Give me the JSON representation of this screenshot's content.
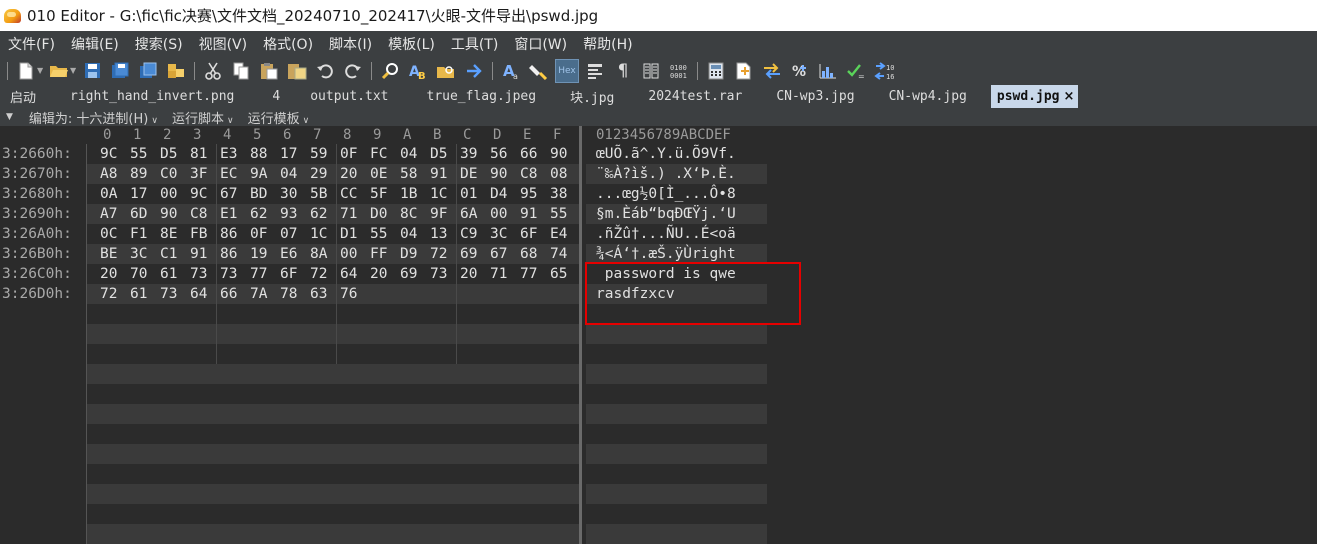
{
  "window": {
    "title": "010 Editor - G:\\fic\\fic决赛\\文件文档_20240710_202417\\火眼-文件导出\\pswd.jpg"
  },
  "menu": [
    "文件(F)",
    "编辑(E)",
    "搜索(S)",
    "视图(V)",
    "格式(O)",
    "脚本(I)",
    "模板(L)",
    "工具(T)",
    "窗口(W)",
    "帮助(H)"
  ],
  "toolbar": {
    "hex_label": "Hex",
    "pilcrow": "¶"
  },
  "tabs": [
    {
      "label": "启动",
      "active": false
    },
    {
      "label": "right_hand_invert.png",
      "active": false
    },
    {
      "label": "4",
      "active": false
    },
    {
      "label": "output.txt",
      "active": false
    },
    {
      "label": "true_flag.jpeg",
      "active": false
    },
    {
      "label": "块.jpg",
      "active": false
    },
    {
      "label": "2024test.rar",
      "active": false
    },
    {
      "label": "CN-wp3.jpg",
      "active": false
    },
    {
      "label": "CN-wp4.jpg",
      "active": false
    },
    {
      "label": "pswd.jpg",
      "active": true
    }
  ],
  "tab_close": "×",
  "editbar": {
    "edit_as": "编辑为: 十六进制(H)",
    "run_script": "运行脚本",
    "run_template": "运行模板"
  },
  "hex_header": [
    "0",
    "1",
    "2",
    "3",
    "4",
    "5",
    "6",
    "7",
    "8",
    "9",
    "A",
    "B",
    "C",
    "D",
    "E",
    "F"
  ],
  "ascii_header": "0123456789ABCDEF",
  "rows": [
    {
      "addr": "3:2660h:",
      "hex": [
        "9C",
        "55",
        "D5",
        "81",
        "E3",
        "88",
        "17",
        "59",
        "0F",
        "FC",
        "04",
        "D5",
        "39",
        "56",
        "66",
        "90"
      ],
      "ascii": "œUÕ.ã^.Y.ü.Õ9Vf."
    },
    {
      "addr": "3:2670h:",
      "hex": [
        "A8",
        "89",
        "C0",
        "3F",
        "EC",
        "9A",
        "04",
        "29",
        "20",
        "0E",
        "58",
        "91",
        "DE",
        "90",
        "C8",
        "08"
      ],
      "ascii": "¨‰À?ìš.) .X‘Þ.È."
    },
    {
      "addr": "3:2680h:",
      "hex": [
        "0A",
        "17",
        "00",
        "9C",
        "67",
        "BD",
        "30",
        "5B",
        "CC",
        "5F",
        "1B",
        "1C",
        "01",
        "D4",
        "95",
        "38"
      ],
      "ascii": "...œg½0[Ì_...Ô•8"
    },
    {
      "addr": "3:2690h:",
      "hex": [
        "A7",
        "6D",
        "90",
        "C8",
        "E1",
        "62",
        "93",
        "62",
        "71",
        "D0",
        "8C",
        "9F",
        "6A",
        "00",
        "91",
        "55"
      ],
      "ascii": "§m.Èáb“bqÐŒŸj.‘U"
    },
    {
      "addr": "3:26A0h:",
      "hex": [
        "0C",
        "F1",
        "8E",
        "FB",
        "86",
        "0F",
        "07",
        "1C",
        "D1",
        "55",
        "04",
        "13",
        "C9",
        "3C",
        "6F",
        "E4"
      ],
      "ascii": ".ñŽû†...ÑU..É<oä"
    },
    {
      "addr": "3:26B0h:",
      "hex": [
        "BE",
        "3C",
        "C1",
        "91",
        "86",
        "19",
        "E6",
        "8A",
        "00",
        "FF",
        "D9",
        "72",
        "69",
        "67",
        "68",
        "74"
      ],
      "ascii": "¾<Á‘†.æŠ.ÿÙright"
    },
    {
      "addr": "3:26C0h:",
      "hex": [
        "20",
        "70",
        "61",
        "73",
        "73",
        "77",
        "6F",
        "72",
        "64",
        "20",
        "69",
        "73",
        "20",
        "71",
        "77",
        "65"
      ],
      "ascii": " password is qwe"
    },
    {
      "addr": "3:26D0h:",
      "hex": [
        "72",
        "61",
        "73",
        "64",
        "66",
        "7A",
        "78",
        "63",
        "76"
      ],
      "ascii": "rasdfzxcv"
    }
  ]
}
